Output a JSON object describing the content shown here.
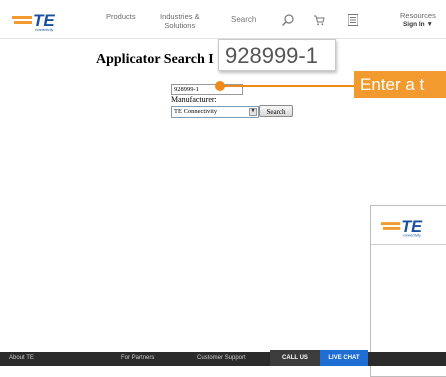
{
  "header": {
    "logo_text": "TE",
    "logo_tagline": "connectivity",
    "nav": {
      "products": "Products",
      "industries_line1": "Industries &",
      "industries_line2": "Solutions",
      "search_label": "Search",
      "resources": "Resources",
      "sign_in": "Sign In ▼"
    },
    "icons": [
      "te-logo-icon",
      "search-icon",
      "cart-icon",
      "menu-icon"
    ]
  },
  "main": {
    "title": "Applicator Search I",
    "part_number_value": "928999-1",
    "manufacturer_label": "Manufacturer:",
    "manufacturer_selected": "TE Connectivity",
    "search_button": "Search"
  },
  "callouts": {
    "zoom_value": "928999-1",
    "instruction": "Enter a t",
    "accent_color": "#f39a2e"
  },
  "footer": {
    "about": "About TE",
    "partners": "For Partners",
    "support": "Customer Support",
    "call": "CALL US",
    "chat": "LIVE CHAT"
  },
  "colors": {
    "brand_orange": "#f39a2e",
    "brand_blue": "#1b4fa0",
    "live_chat_blue": "#1f6ed4",
    "footer_bg": "#2b2b2b"
  }
}
